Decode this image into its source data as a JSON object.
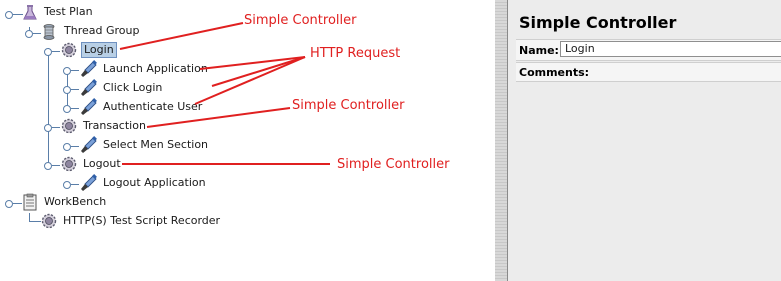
{
  "tree": {
    "nodes": [
      {
        "label": "Test Plan",
        "icon": "flask-icon"
      },
      {
        "label": "Thread Group",
        "icon": "spool-icon"
      },
      {
        "label": "Login",
        "icon": "gear-icon",
        "selected": true
      },
      {
        "label": "Launch Application",
        "icon": "pipette-icon"
      },
      {
        "label": "Click Login",
        "icon": "pipette-icon"
      },
      {
        "label": "Authenticate User",
        "icon": "pipette-icon"
      },
      {
        "label": "Transaction",
        "icon": "gear-icon"
      },
      {
        "label": "Select Men Section",
        "icon": "pipette-icon"
      },
      {
        "label": "Logout",
        "icon": "gear-icon"
      },
      {
        "label": "Logout Application",
        "icon": "pipette-icon"
      },
      {
        "label": "WorkBench",
        "icon": "clipboard-icon"
      },
      {
        "label": "HTTP(S) Test Script Recorder",
        "icon": "gear-icon"
      }
    ]
  },
  "annotations": {
    "simple_controller_1": "Simple Controller",
    "http_request": "HTTP Request",
    "simple_controller_2": "Simple Controller",
    "simple_controller_3": "Simple Controller",
    "color": "#e02020"
  },
  "detail": {
    "title": "Simple Controller",
    "name_label": "Name:",
    "name_value": "Login",
    "comments_label": "Comments:"
  }
}
